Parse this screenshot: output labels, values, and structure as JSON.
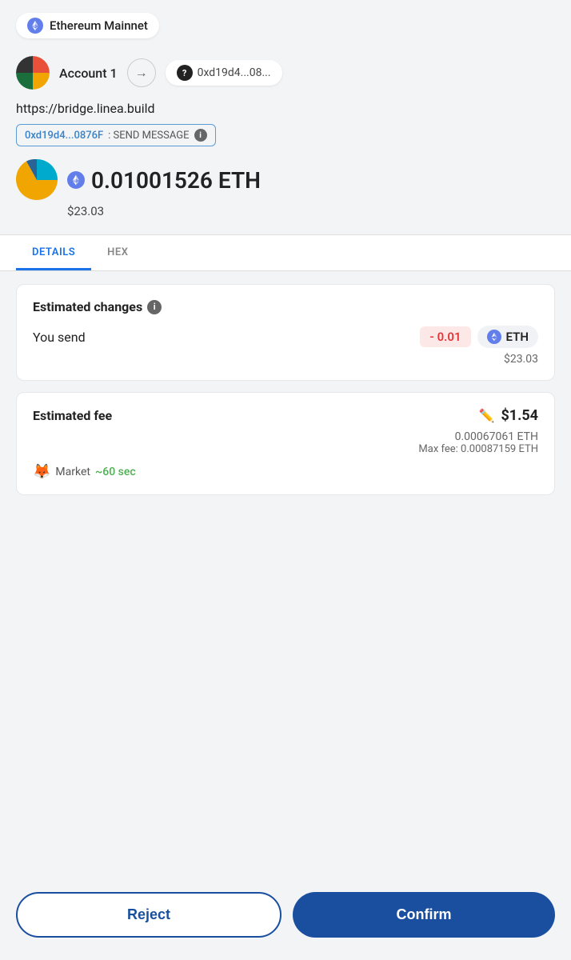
{
  "network": {
    "label": "Ethereum Mainnet"
  },
  "account": {
    "name": "Account 1",
    "to_address": "0xd19d4...08..."
  },
  "site": {
    "url": "https://bridge.linea.build",
    "contract_address": "0xd19d4...0876F",
    "contract_label": ": SEND MESSAGE"
  },
  "transaction": {
    "eth_amount": "0.01001526 ETH",
    "usd_value": "$23.03"
  },
  "tabs": {
    "details_label": "DETAILS",
    "hex_label": "HEX"
  },
  "estimated_changes": {
    "title": "Estimated changes",
    "you_send_label": "You send",
    "send_amount": "- 0.01",
    "token": "ETH",
    "send_usd": "$23.03"
  },
  "estimated_fee": {
    "title": "Estimated fee",
    "fee_usd": "$1.54",
    "fee_eth": "0.00067061 ETH",
    "max_fee": "Max fee: 0.00087159 ETH",
    "market_label": "Market",
    "market_time": "~60 sec"
  },
  "buttons": {
    "reject_label": "Reject",
    "confirm_label": "Confirm"
  }
}
